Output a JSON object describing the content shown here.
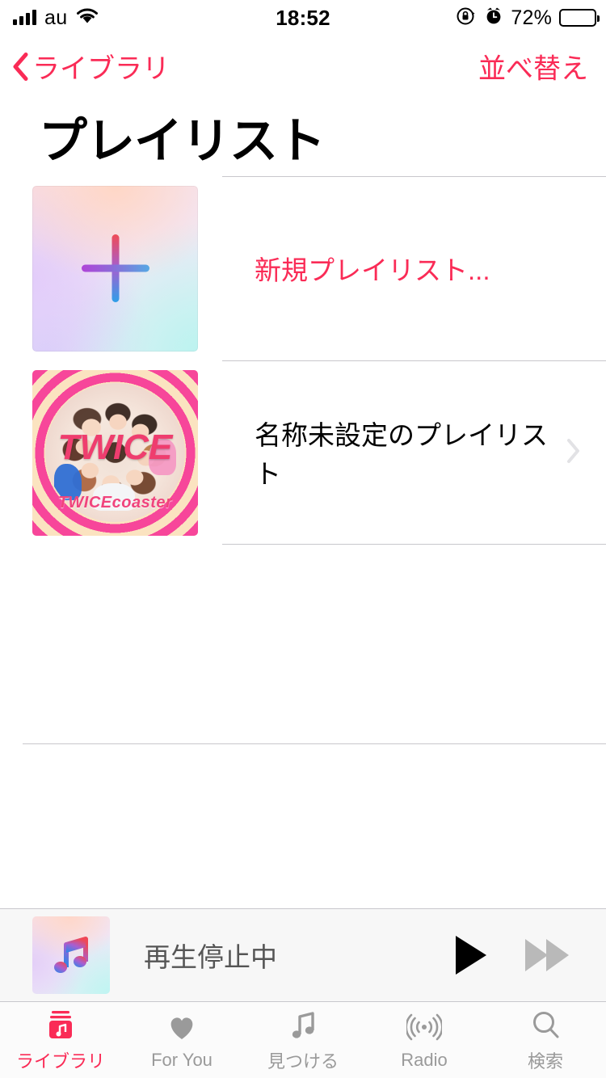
{
  "status_bar": {
    "carrier": "au",
    "signal_bars": 4,
    "wifi_icon": "wifi-icon",
    "time": "18:52",
    "rotation_lock_icon": "rotation-lock-icon",
    "alarm_icon": "alarm-clock-icon",
    "battery_percent": "72%",
    "battery_level": 72
  },
  "nav_bar": {
    "back_icon": "chevron-left-icon",
    "back_label": "ライブラリ",
    "right_action": "並べ替え",
    "accent_color": "#FA2B56"
  },
  "page_title": "プレイリスト",
  "list": {
    "rows": [
      {
        "label": "新規プレイリスト...",
        "accent": true,
        "artwork": "new-playlist-gradient-tile",
        "icon": "plus-icon",
        "disclosure": false
      },
      {
        "label": "名称未設定のプレイリスト",
        "accent": false,
        "artwork": "twicecoaster-album-art",
        "album_logo": "TWICE",
        "album_title": "TWICEcoaster",
        "disclosure": true,
        "disclosure_icon": "chevron-right-icon"
      }
    ]
  },
  "mini_player": {
    "artwork_icon": "apple-music-note-icon",
    "title": "再生停止中",
    "play_icon": "play-icon",
    "forward_icon": "fast-forward-icon",
    "forward_disabled": true
  },
  "tab_bar": {
    "tabs": [
      {
        "label": "ライブラリ",
        "icon": "library-icon",
        "active": true
      },
      {
        "label": "For You",
        "icon": "heart-icon",
        "active": false
      },
      {
        "label": "見つける",
        "icon": "music-note-icon",
        "active": false
      },
      {
        "label": "Radio",
        "icon": "radio-waves-icon",
        "active": false
      },
      {
        "label": "検索",
        "icon": "search-icon",
        "active": false
      }
    ]
  },
  "colors": {
    "accent": "#FA2B56",
    "inactive": "#9a9a9a",
    "separator": "#c8c7cc",
    "bar_background": "#f7f7f7"
  }
}
